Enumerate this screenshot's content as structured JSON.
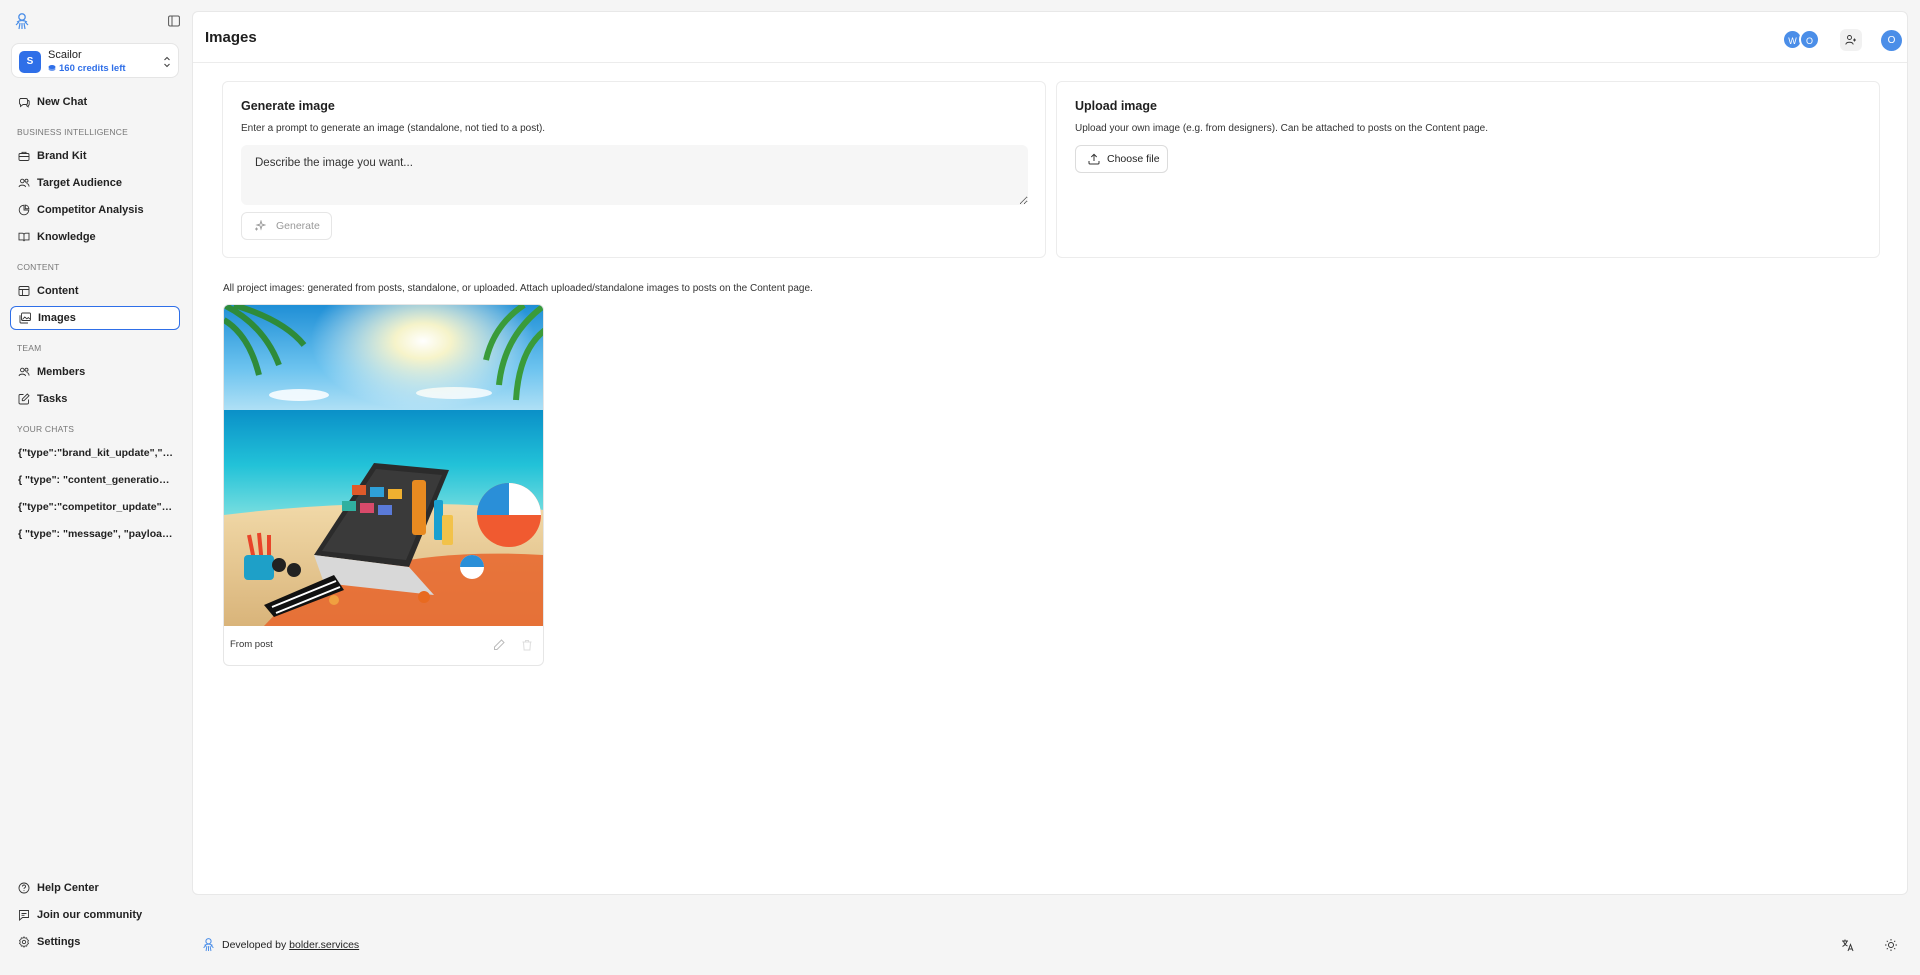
{
  "sidebar": {
    "project": {
      "initial": "S",
      "name": "Scailor",
      "credits": "160 credits left"
    },
    "top_nav": [
      {
        "label": "New Chat",
        "icon": "chat-icon"
      }
    ],
    "sections": {
      "business_intelligence": "BUSINESS INTELLIGENCE",
      "content": "CONTENT",
      "team": "TEAM",
      "your_chats": "YOUR CHATS"
    },
    "bi_items": [
      {
        "label": "Brand Kit",
        "icon": "briefcase-icon"
      },
      {
        "label": "Target Audience",
        "icon": "users-icon"
      },
      {
        "label": "Competitor Analysis",
        "icon": "chart-icon"
      },
      {
        "label": "Knowledge",
        "icon": "book-icon"
      }
    ],
    "content_items": [
      {
        "label": "Content",
        "icon": "table-icon"
      },
      {
        "label": "Images",
        "icon": "images-icon",
        "active": true
      }
    ],
    "team_items": [
      {
        "label": "Members",
        "icon": "users-icon"
      },
      {
        "label": "Tasks",
        "icon": "edit-square-icon"
      }
    ],
    "chats": [
      "{\"type\":\"brand_kit_update\",\"pa...",
      "{ \"type\": \"content_generation\", \"...",
      "{\"type\":\"competitor_update\",\"p...",
      "{ \"type\": \"message\", \"payload\": { \"..."
    ],
    "bottom_items": [
      {
        "label": "Help Center",
        "icon": "help-icon"
      },
      {
        "label": "Join our community",
        "icon": "message-icon"
      },
      {
        "label": "Settings",
        "icon": "gear-icon"
      }
    ]
  },
  "header": {
    "title": "Images",
    "collaborators": [
      "W",
      "O"
    ],
    "user_initial": "O"
  },
  "generate": {
    "title": "Generate image",
    "description": "Enter a prompt to generate an image (standalone, not tied to a post).",
    "placeholder": "Describe the image you want...",
    "button": "Generate"
  },
  "upload": {
    "title": "Upload image",
    "description": "Upload your own image (e.g. from designers). Can be attached to posts on the Content page.",
    "button": "Choose file"
  },
  "gallery": {
    "description": "All project images: generated from posts, standalone, or uploaded. Attach uploaded/standalone images to posts on the Content page.",
    "images": [
      {
        "source": "From post",
        "alt": "Beach scene with laptop, sunscreen and beach ball"
      }
    ]
  },
  "footer": {
    "prefix": "Developed by ",
    "link": "bolder.services"
  },
  "colors": {
    "accent": "#2f6fe8",
    "avatar": "#4b8ee8",
    "background": "#f5f5f5"
  }
}
